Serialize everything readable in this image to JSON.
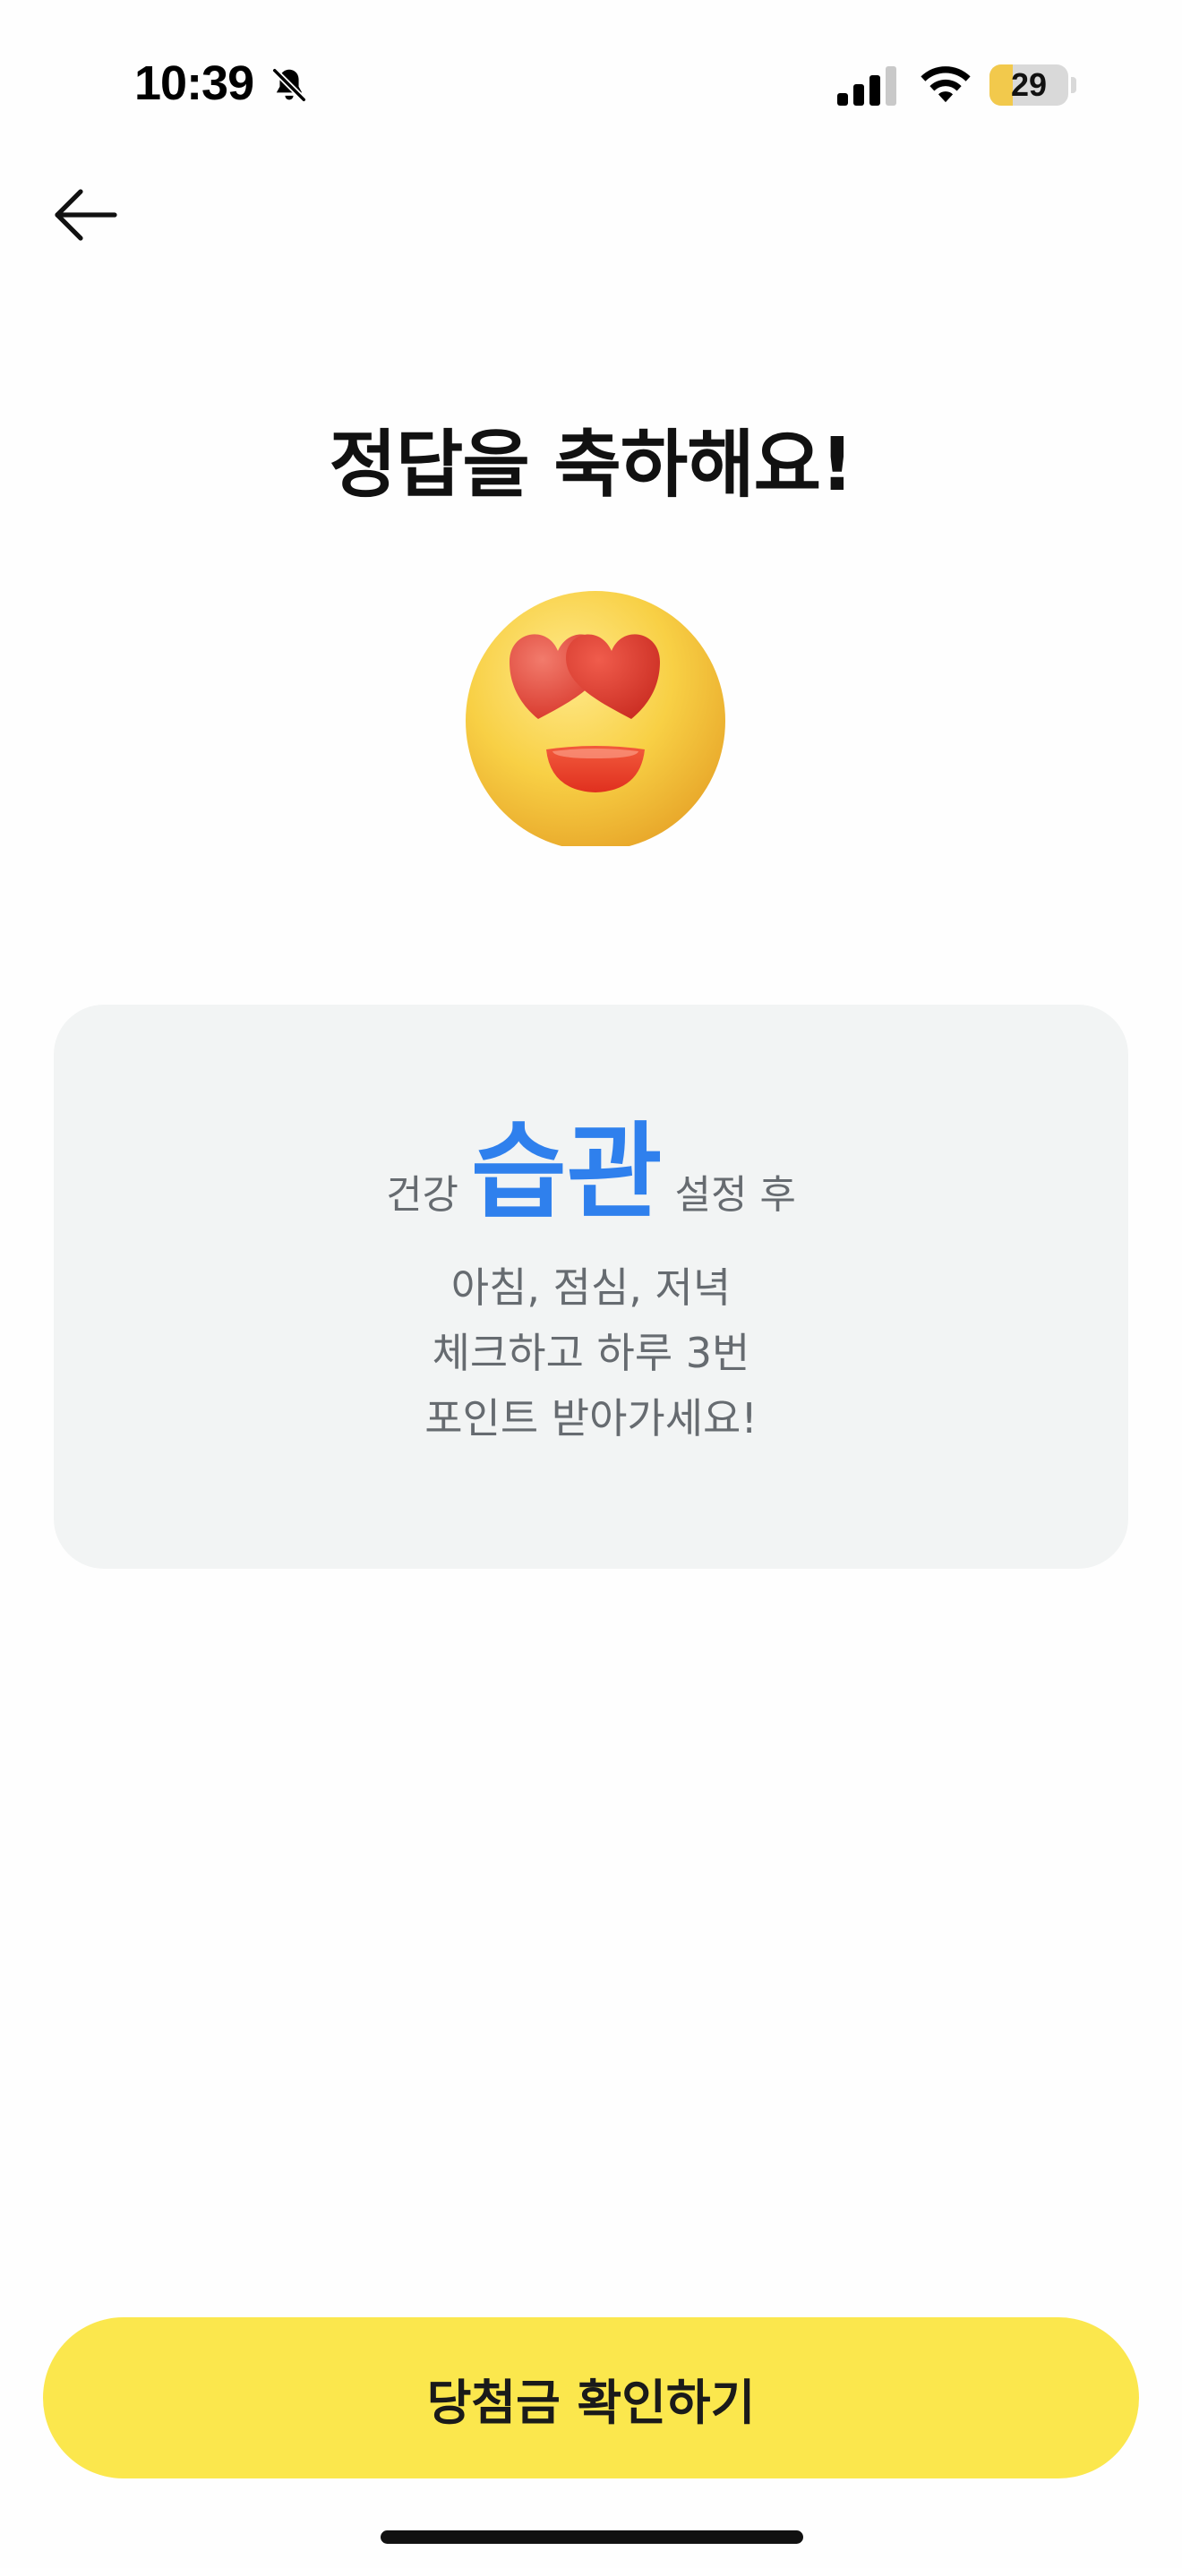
{
  "status_bar": {
    "time": "10:39",
    "mute_icon": "bell-slash-icon",
    "signal_icon": "cellular-signal-icon",
    "wifi_icon": "wifi-icon",
    "battery_level": "29",
    "battery_fraction": 0.29,
    "battery_color": "#f2c94c"
  },
  "nav": {
    "back_icon": "arrow-left-icon"
  },
  "title": "정답을 축하해요!",
  "emoji": "heart-eyes-emoji",
  "card": {
    "prefix": "건강",
    "highlight": "습관",
    "suffix": "설정 후",
    "lines": [
      "아침, 점심, 저녁",
      "체크하고 하루 3번",
      "포인트 받아가세요!"
    ],
    "highlight_color": "#2f80ed"
  },
  "cta": {
    "label": "당첨금 확인하기",
    "color": "#fbe74d"
  }
}
